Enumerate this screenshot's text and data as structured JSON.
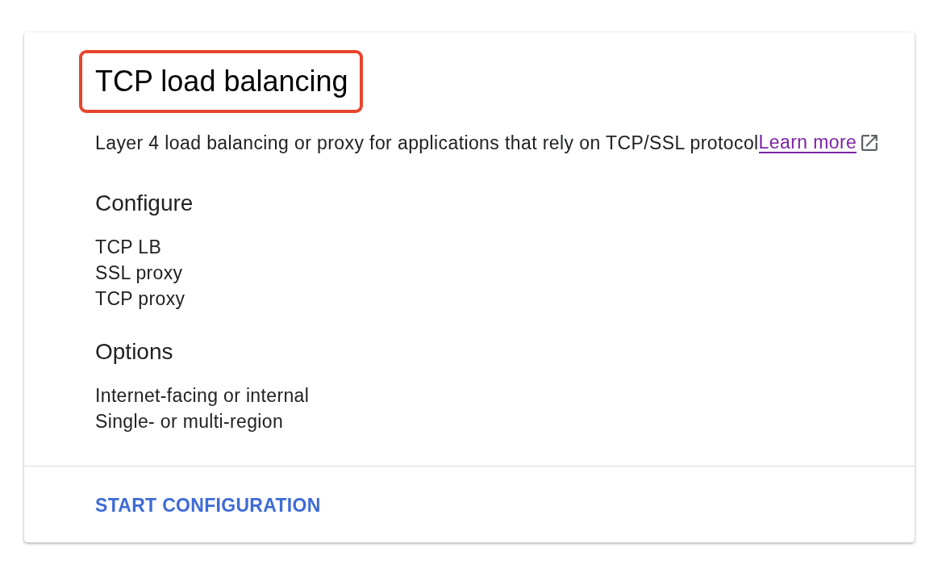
{
  "card": {
    "title": {
      "text": "TCP load balancing",
      "highlighted": true
    },
    "description": {
      "text": "Layer 4 load balancing or proxy for applications that rely on TCP/SSL protocol",
      "link": "Learn more",
      "visited": true
    },
    "sections": [
      {
        "heading": "Configure",
        "items": [
          "TCP LB",
          "SSL proxy",
          "TCP proxy"
        ]
      },
      {
        "heading": "Options",
        "items": [
          "Internet-facing or internal",
          "Single- or multi-region"
        ]
      }
    ],
    "action": {
      "label": "START CONFIGURATION"
    }
  }
}
